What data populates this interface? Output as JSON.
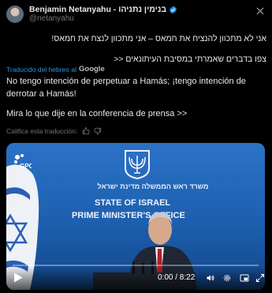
{
  "author": {
    "name": "Benjamin Netanyahu - בנימין נתניהו",
    "handle": "@netanyahu",
    "verified": true
  },
  "tweet": {
    "hebrew_line1": "אני לא מתכוון להנציח את חמאס – אני מתכוון לנצח את חמאס!",
    "hebrew_line2": "צפו בדברים שאמרתי במסיבת העיתונאים <<"
  },
  "translation": {
    "label": "Traducido del hebreo al",
    "provider": "Google",
    "spanish_para1": "No tengo intención de perpetuar a Hamás; ¡tengo intención de derrotar a Hamás!",
    "spanish_para2": "Mira lo que dije en la conferencia de prensa >>",
    "rate_prompt": "Califica esta traducción:"
  },
  "video": {
    "watermark": "GPO",
    "sign_hebrew": "משרד ראש הממשלה  מדינת ישראל",
    "sign_line1": "STATE OF ISRAEL",
    "sign_line2": "PRIME MINISTER'S OFFICE",
    "current_time": "0:00",
    "duration": "8:22",
    "time_display": "0:00 / 8:22",
    "progress": 0.0
  },
  "colors": {
    "accent": "#1d9bf0",
    "text": "#e7e9ea",
    "muted": "#71767b",
    "background": "#000000"
  }
}
